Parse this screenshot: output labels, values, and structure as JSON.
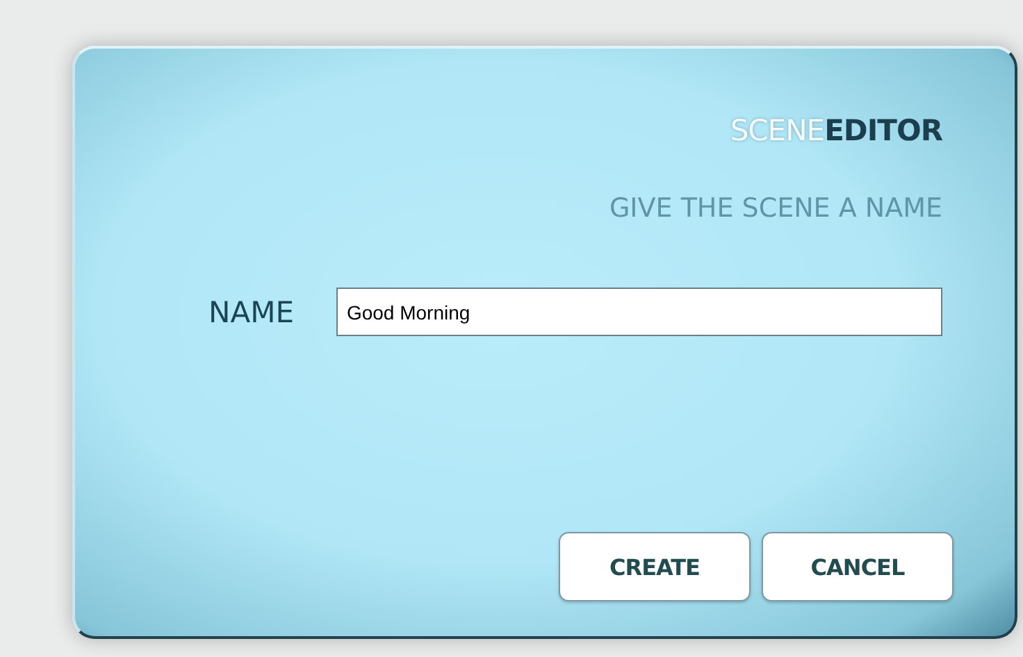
{
  "title": {
    "light": "SCENE",
    "bold": "EDITOR"
  },
  "subtitle": "GIVE THE SCENE A NAME",
  "name_field": {
    "label": "NAME",
    "value": "Good Morning"
  },
  "buttons": [
    "CREATE",
    "CANCEL"
  ]
}
